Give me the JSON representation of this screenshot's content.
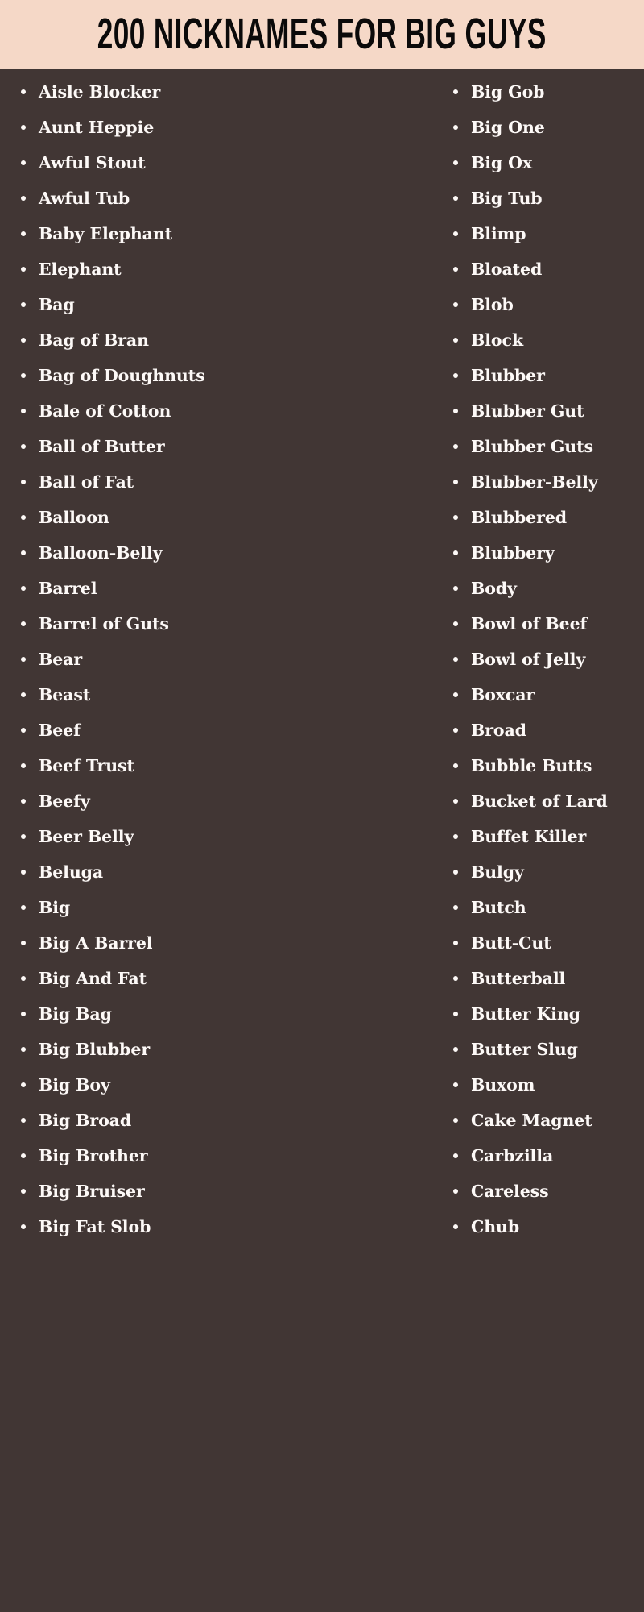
{
  "page": {
    "background_color": "#413634",
    "text_color": "#FDF9F7"
  },
  "header": {
    "title": "200 NICKNAMES FOR BIG GUYS",
    "background_color": "#F5D8C7",
    "title_color": "#0B0A0A"
  },
  "columns": {
    "left": {
      "items": [
        "Aisle Blocker",
        "Aunt Heppie",
        "Awful Stout",
        "Awful Tub",
        "Baby Elephant",
        "Elephant",
        "Bag",
        "Bag of Bran",
        "Bag of Doughnuts",
        "Bale of Cotton",
        "Ball of Butter",
        "Ball of Fat",
        "Balloon",
        "Balloon-Belly",
        "Barrel",
        "Barrel of Guts",
        "Bear",
        "Beast",
        "Beef",
        "Beef Trust",
        "Beefy",
        "Beer Belly",
        "Beluga",
        "Big",
        "Big A Barrel",
        "Big And Fat",
        "Big Bag",
        "Big Blubber",
        "Big Boy",
        "Big Broad",
        "Big Brother",
        "Big Bruiser",
        "Big Fat Slob"
      ]
    },
    "right": {
      "items": [
        "Big Gob",
        "Big One",
        "Big Ox",
        "Big Tub",
        "Blimp",
        "Bloated",
        "Blob",
        "Block",
        "Blubber",
        "Blubber Gut",
        "Blubber Guts",
        "Blubber-Belly",
        "Blubbered",
        "Blubbery",
        "Body",
        "Bowl of Beef",
        "Bowl of Jelly",
        "Boxcar",
        "Broad",
        "Bubble Butts",
        "Bucket of Lard",
        "Buffet Killer",
        "Bulgy",
        "Butch",
        "Butt-Cut",
        "Butterball",
        "Butter King",
        "Butter Slug",
        "Buxom",
        "Cake Magnet",
        "Carbzilla",
        "Careless",
        "Chub"
      ]
    }
  }
}
